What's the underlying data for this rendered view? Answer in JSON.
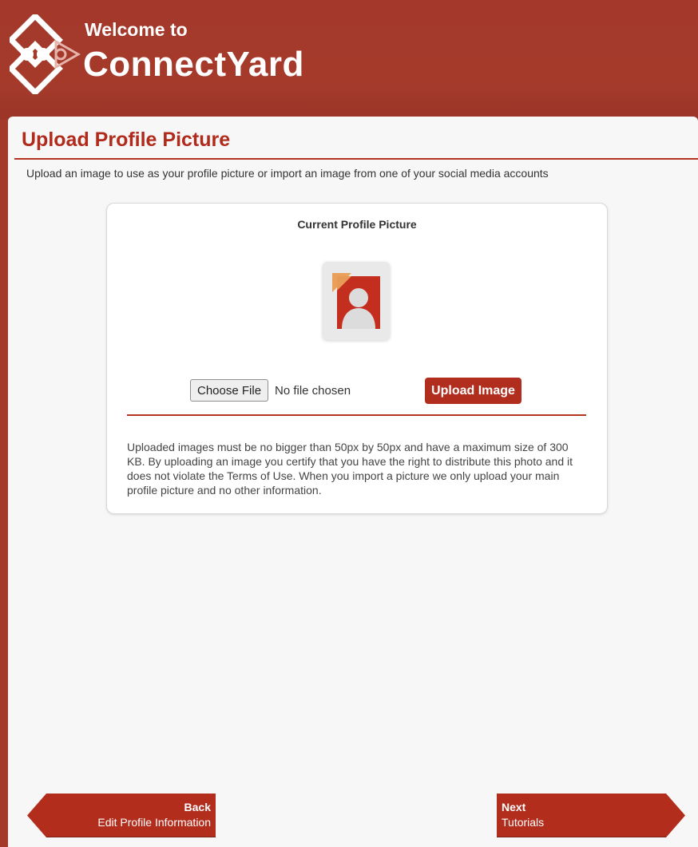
{
  "header": {
    "welcome": "Welcome to",
    "brand": "ConnectYard",
    "logo_icon": "diamond-logo-icon"
  },
  "page": {
    "title": "Upload Profile Picture",
    "intro": "Upload an image to use as your profile picture or import an image from one of your social media accounts"
  },
  "card": {
    "heading": "Current Profile Picture",
    "avatar_icon": "default-avatar-icon",
    "choose_file_label": "Choose File",
    "file_status": "No file chosen",
    "upload_label": "Upload Image",
    "disclaimer": "Uploaded images must be no bigger than 50px by 50px and have a maximum size of 300 KB. By uploading an image you certify that you have the right to distribute this photo and it does not violate the Terms of Use. When you import a picture we only upload your main profile picture and no other information."
  },
  "nav": {
    "back": {
      "title": "Back",
      "subtitle": "Edit Profile Information"
    },
    "next": {
      "title": "Next",
      "subtitle": "Tutorials"
    }
  },
  "colors": {
    "brand_red": "#a33a2a",
    "accent_red": "#b12d1e",
    "panel_bg": "#f7f7f7"
  }
}
